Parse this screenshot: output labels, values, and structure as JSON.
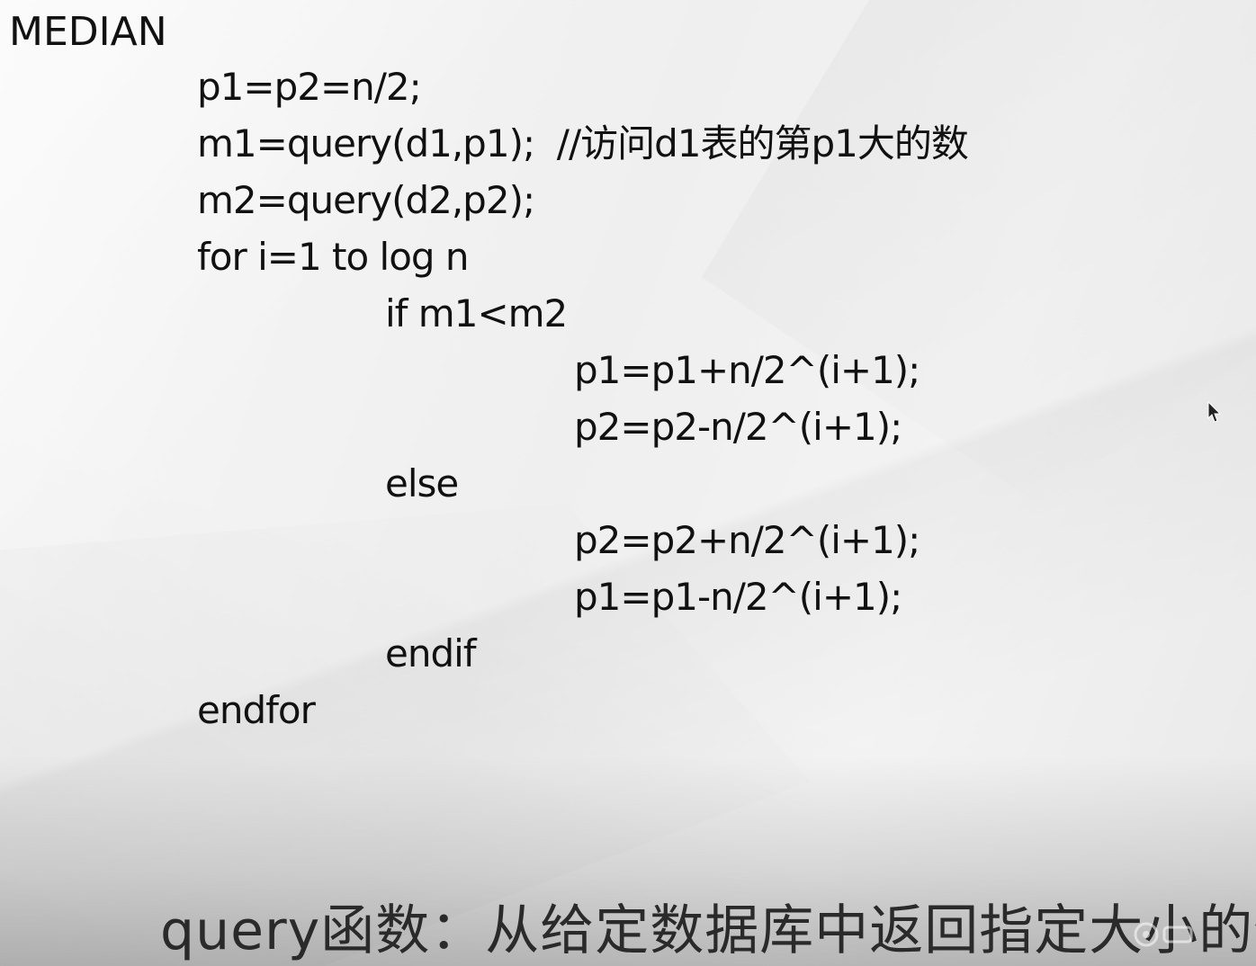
{
  "slide": {
    "title": "MEDIAN",
    "code_lines": [
      "p1=p2=n/2;",
      "m1=query(d1,p1);  //访问d1表的第p1大的数",
      "m2=query(d2,p2);",
      "for i=1 to log n",
      "if m1<m2",
      "p1=p1+n/2^(i+1);",
      "p2=p2-n/2^(i+1);",
      "else",
      "p2=p2+n/2^(i+1);",
      "p1=p1-n/2^(i+1);",
      "endif",
      "endfor"
    ]
  },
  "subtitle": "query函数：从给定数据库中返回指定大小的值",
  "icons": {
    "cursor": "mouse-pointer-icon",
    "watermark": "watermark-logo-icon"
  }
}
